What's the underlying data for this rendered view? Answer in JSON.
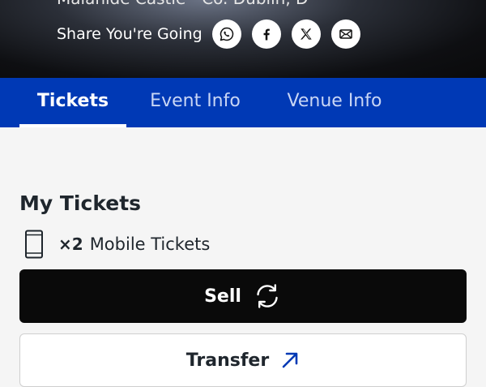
{
  "header": {
    "venue_line": "Malahide Castle - Co. Dublin, D",
    "share_label": "Share You're Going",
    "share_icons": [
      "whatsapp-icon",
      "facebook-icon",
      "x-icon",
      "mail-icon"
    ]
  },
  "tabs": [
    {
      "label": "Tickets",
      "active": true
    },
    {
      "label": "Event Info",
      "active": false
    },
    {
      "label": "Venue Info",
      "active": false
    }
  ],
  "tickets": {
    "title": "My Tickets",
    "count_prefix": "×2",
    "count_label": "Mobile Tickets",
    "count_icon": "mobile-phone-icon"
  },
  "actions": {
    "sell_label": "Sell",
    "sell_icon": "refresh-icon",
    "transfer_label": "Transfer",
    "transfer_icon": "arrow-up-right-icon"
  },
  "colors": {
    "tab_bar": "#0039b5",
    "sell_button": "#0a0a0a",
    "accent_blue": "#0039b5"
  }
}
